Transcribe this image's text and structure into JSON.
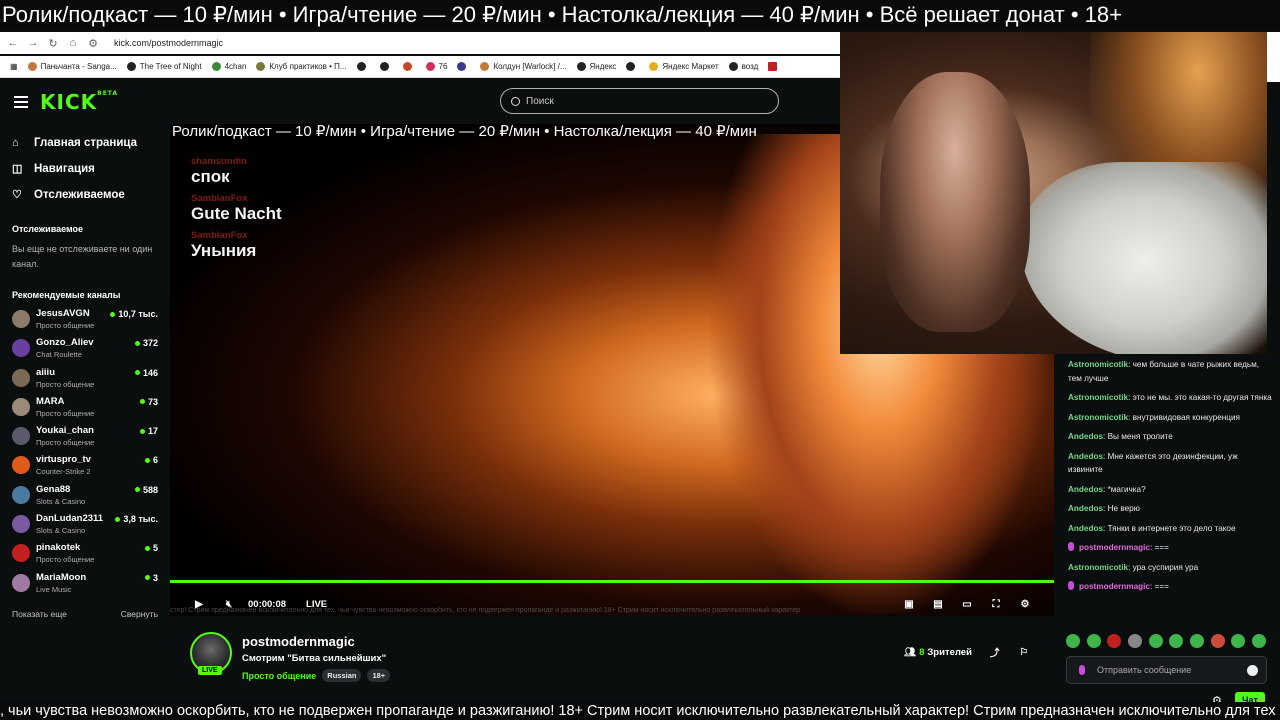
{
  "ticker_top": "Ролик/подкаст — 10 ₽/мин • Игра/чтение — 20 ₽/мин • Настолка/лекция — 40 ₽/мин • Всё решает донат • 18+",
  "browser": {
    "url": "kick.com/postmodernmagic",
    "bookmarks": [
      "Паньчанта - Sanga...",
      "The Tree of Night",
      "4chan",
      "Клуб практиков • П...",
      "",
      "",
      "",
      "76",
      "",
      "Колдун [Warlock] /...",
      "Яндекс",
      "",
      "Яндекс Маркет",
      "возд"
    ]
  },
  "header": {
    "logo": "KICK",
    "logo_sup": "BETA",
    "search_placeholder": "Поиск"
  },
  "sidebar": {
    "nav": [
      {
        "label": "Главная страница",
        "icon": "home-icon"
      },
      {
        "label": "Навигация",
        "icon": "compass-icon"
      },
      {
        "label": "Отслеживаемое",
        "icon": "heart-icon"
      }
    ],
    "following_title": "Отслеживаемое",
    "following_empty": "Вы еще не отслеживаете ни один канал.",
    "recommended_title": "Рекомендуемые каналы",
    "channels": [
      {
        "name": "JesusAVGN",
        "category": "Просто общение",
        "viewers": "10,7 тыс.",
        "color": "#8c7a6a"
      },
      {
        "name": "Gonzo_Aliev",
        "category": "Chat Roulette",
        "viewers": "372",
        "color": "#6a3fa0"
      },
      {
        "name": "aiiiu",
        "category": "Просто общение",
        "viewers": "146",
        "color": "#7a6a55"
      },
      {
        "name": "MARA",
        "category": "Просто общение",
        "viewers": "73",
        "color": "#9a8a7a"
      },
      {
        "name": "Youkai_chan",
        "category": "Просто общение",
        "viewers": "17",
        "color": "#5a5a6a"
      },
      {
        "name": "virtuspro_tv",
        "category": "Counter-Strike 2",
        "viewers": "6",
        "color": "#e05a1a"
      },
      {
        "name": "Gena88",
        "category": "Slots & Casino",
        "viewers": "588",
        "color": "#4a7aa0"
      },
      {
        "name": "DanLudan2311",
        "category": "Slots & Casino",
        "viewers": "3,8 тыс.",
        "color": "#7a5aa0"
      },
      {
        "name": "pinakotek",
        "category": "Просто общение",
        "viewers": "5",
        "color": "#c02020"
      },
      {
        "name": "MariaMoon",
        "category": "Live Music",
        "viewers": "3",
        "color": "#a07aa0"
      }
    ],
    "show_more": "Показать еще",
    "collapse": "Свернуть"
  },
  "video": {
    "ticker": "Ролик/подкаст — 10 ₽/мин • Игра/чтение — 20 ₽/мин • Настолка/лекция — 40 ₽/мин",
    "overlay_chat": [
      {
        "user": "shamsundin",
        "msg": "спок"
      },
      {
        "user": "SambianFox",
        "msg": "Gute Nacht"
      },
      {
        "user": "SambianFox",
        "msg": "Уныния"
      }
    ],
    "time": "00:00:08",
    "live": "LIVE",
    "progress": 1.0,
    "subtitle_strip": "стер! Стрим предназначен исключительно для тех, чьи чувства невозможно оскорбить, кто не подвержен пропаганде и разжиганию! 18+ Стрим носит исключительно развлекательный характер"
  },
  "stream": {
    "name": "postmodernmagic",
    "title": "Смотрим \"Битва сильнейших\"",
    "category": "Просто общение",
    "tags": [
      "Russian",
      "18+"
    ],
    "live_badge": "LIVE",
    "viewers_count": "8",
    "viewers_label": "Зрителей"
  },
  "chat": {
    "messages": [
      {
        "user": "Astronomicotik",
        "text": "чем больше в чате рыжих ведьм, тем лучше",
        "mod": false
      },
      {
        "user": "Astronomicotik",
        "text": "это не мы. это какая-то другая тянка",
        "mod": false
      },
      {
        "user": "Astronomicotik",
        "text": "внутривидовая конкуренция",
        "mod": false
      },
      {
        "user": "Andedos",
        "text": "Вы меня тролите",
        "mod": false
      },
      {
        "user": "Andedos",
        "text": "Мне кажется это дезинфекции, уж извините",
        "mod": false
      },
      {
        "user": "Andedos",
        "text": "*магичка?",
        "mod": false
      },
      {
        "user": "Andedos",
        "text": "Не верю",
        "mod": false
      },
      {
        "user": "Andedos",
        "text": "Тянки в интернете это дело такое",
        "mod": false
      },
      {
        "user": "postmodernmagic",
        "text": "===",
        "mod": true
      },
      {
        "user": "Astronomicotik",
        "text": "ура суспирия ура",
        "mod": false
      },
      {
        "user": "postmodernmagic",
        "text": "===",
        "mod": true
      }
    ],
    "input_placeholder": "Отправить сообщение",
    "send_label": "Чат"
  },
  "ticker_bottom": ", чьи чувства невозможно оскорбить, кто не подвержен пропаганде и разжиганию! 18+ Стрим носит исключительно развлекательный характер! Стрим предназначен исключительно для тех"
}
